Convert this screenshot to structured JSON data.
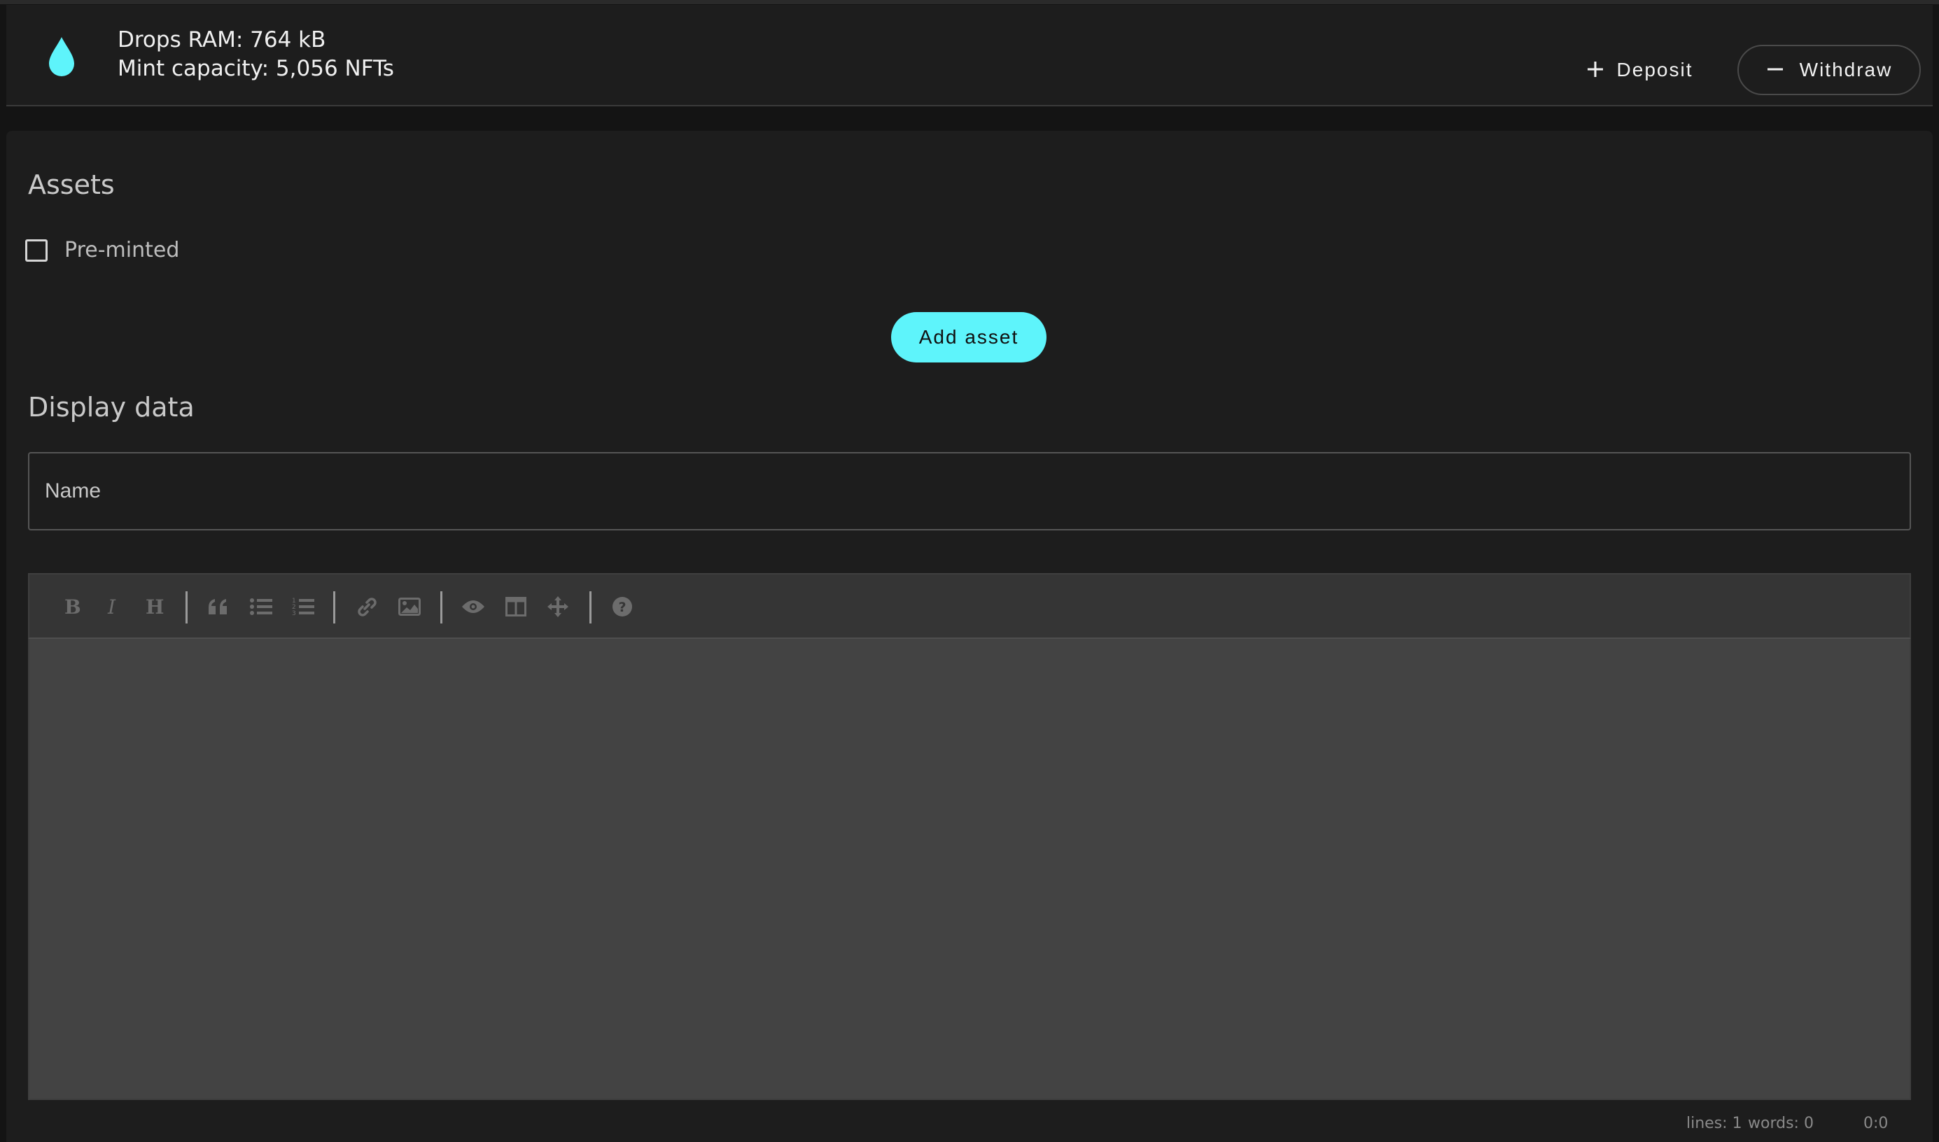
{
  "header": {
    "ram_label": "Drops RAM: 764 kB",
    "capacity_label": "Mint capacity: 5,056 NFTs",
    "deposit_label": "Deposit",
    "withdraw_label": "Withdraw",
    "icons": {
      "logo": "water-drop-icon",
      "deposit": "plus-icon",
      "withdraw": "minus-icon"
    },
    "accent_color": "#5ef4fb"
  },
  "assets": {
    "title": "Assets",
    "preminted_label": "Pre-minted",
    "preminted_checked": false,
    "add_asset_label": "Add asset"
  },
  "display_data": {
    "title": "Display data",
    "name_placeholder": "Name",
    "name_value": ""
  },
  "editor": {
    "toolbar": [
      "bold-icon",
      "italic-icon",
      "heading-icon",
      "quote-icon",
      "unordered-list-icon",
      "ordered-list-icon",
      "link-icon",
      "image-icon",
      "preview-icon",
      "side-by-side-icon",
      "fullscreen-icon",
      "help-icon"
    ],
    "status": {
      "lines": "lines: 1",
      "words": "words: 0",
      "cursor": "0:0"
    }
  }
}
